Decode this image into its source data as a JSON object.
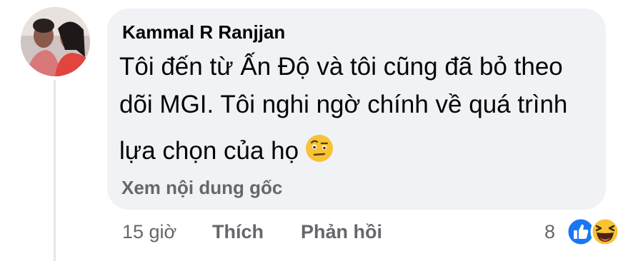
{
  "comment": {
    "author": "Kammal R Ranjjan",
    "text_lines": [
      "Tôi đến từ Ấn Độ và tôi cũng đã bỏ theo",
      "dõi MGI. Tôi nghi ngờ chính về quá trình",
      "lựa chọn của họ"
    ],
    "inline_emoji": "face-with-raised-eyebrow-icon",
    "see_original": "Xem nội dung gốc"
  },
  "actions": {
    "time": "15 giờ",
    "like": "Thích",
    "reply": "Phản hồi"
  },
  "reactions": {
    "count": "8",
    "icons": [
      "like-reaction-icon",
      "haha-reaction-icon"
    ]
  },
  "colors": {
    "bubble": "#f0f2f5",
    "text": "#050505",
    "secondary": "#65676b",
    "like_blue": "#1877f2",
    "emoji_yellow": "#f7c234"
  }
}
